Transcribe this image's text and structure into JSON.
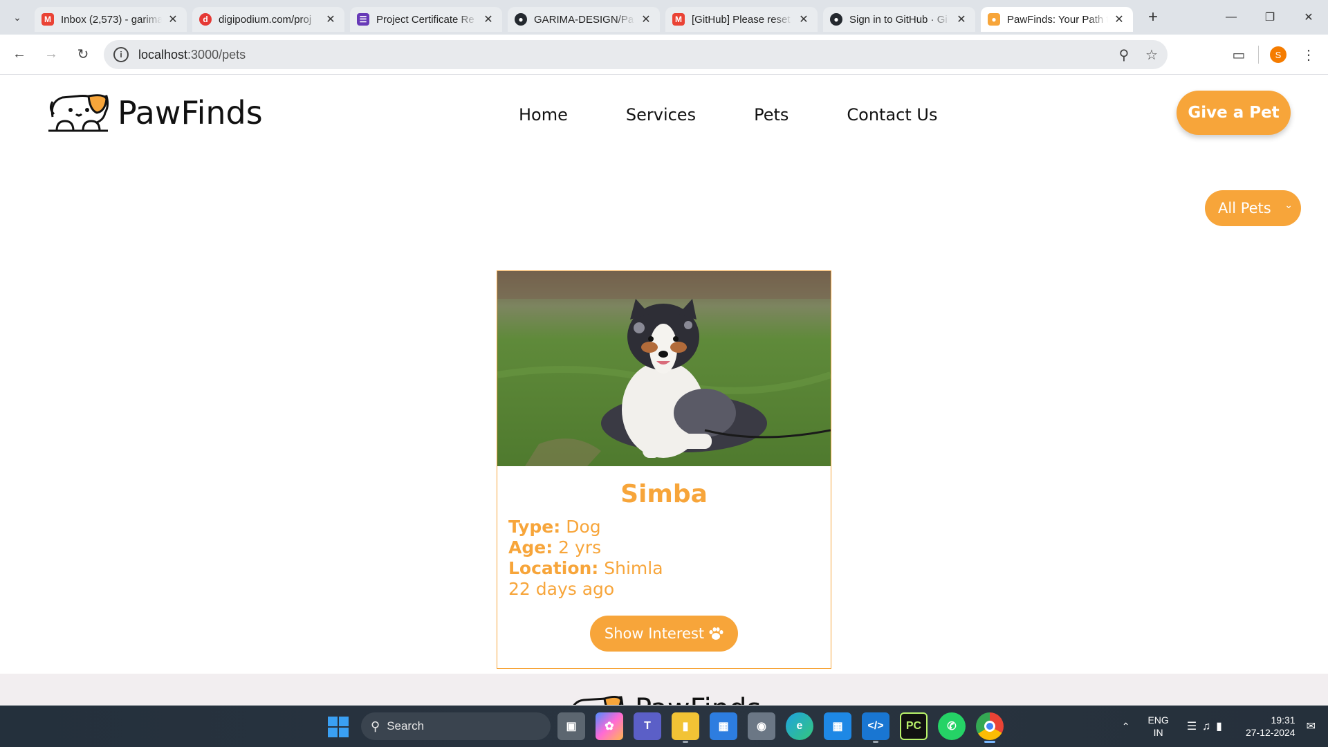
{
  "browser": {
    "tabs": [
      {
        "title": "Inbox (2,573) - garima",
        "favicon": "gmail-icon",
        "color": "#ea4335",
        "active": false
      },
      {
        "title": "digipodium.com/proj",
        "favicon": "digipodium-icon",
        "color": "#e53935",
        "active": false
      },
      {
        "title": "Project Certificate Re",
        "favicon": "forms-icon",
        "color": "#673ab7",
        "active": false
      },
      {
        "title": "GARIMA-DESIGN/Pa",
        "favicon": "github-icon",
        "color": "#24292f",
        "active": false
      },
      {
        "title": "[GitHub] Please reset",
        "favicon": "gmail-icon",
        "color": "#ea4335",
        "active": false
      },
      {
        "title": "Sign in to GitHub · Gi",
        "favicon": "github-icon",
        "color": "#24292f",
        "active": false
      },
      {
        "title": "PawFinds: Your Path t",
        "favicon": "pawfinds-icon",
        "color": "#f7a53a",
        "active": true
      }
    ],
    "url_host": "localhost",
    "url_path": ":3000/pets",
    "profile_initial": "S"
  },
  "site": {
    "brand": "PawFinds",
    "nav": [
      "Home",
      "Services",
      "Pets",
      "Contact Us"
    ],
    "cta": "Give a Pet",
    "filter": {
      "selected": "All Pets"
    },
    "accent_color": "#f7a53a"
  },
  "pet_card": {
    "name": "Simba",
    "type_label": "Type:",
    "type_value": "Dog",
    "age_label": "Age:",
    "age_value": "2 yrs",
    "location_label": "Location:",
    "location_value": "Shimla",
    "posted": "22 days ago",
    "button": "Show Interest"
  },
  "footer": {
    "brand": "PawFinds"
  },
  "taskbar": {
    "search_placeholder": "Search",
    "lang_line1": "ENG",
    "lang_line2": "IN",
    "time": "19:31",
    "date": "27-12-2024",
    "apps": [
      "task-view-icon",
      "copilot-icon",
      "teams-icon",
      "file-explorer-icon",
      "store-icon",
      "camera-icon",
      "edge-icon",
      "app-icon",
      "vscode-icon",
      "pycharm-icon",
      "whatsapp-icon",
      "chrome-icon"
    ]
  }
}
